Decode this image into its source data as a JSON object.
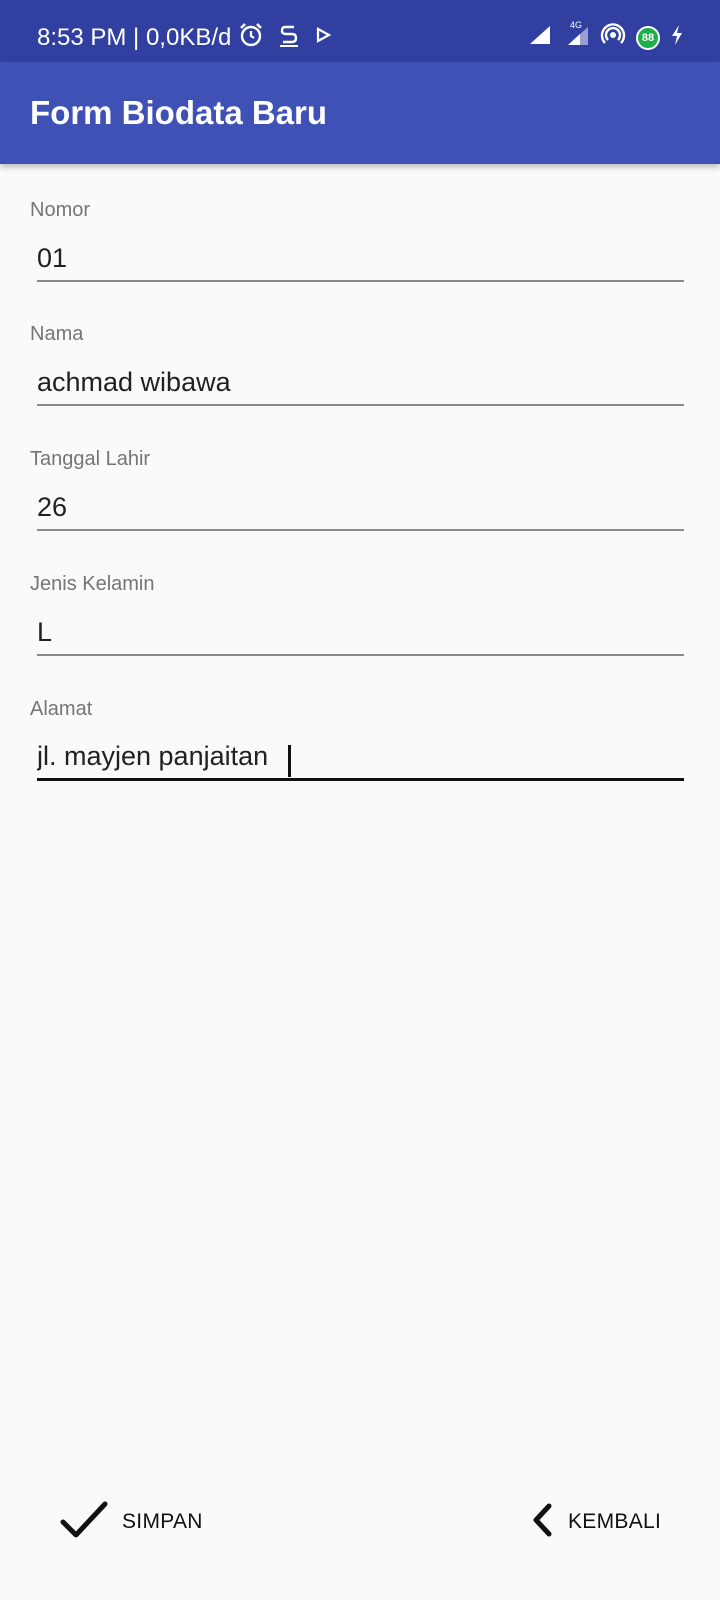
{
  "status_bar": {
    "time": "8:53 PM | 0,0KB/d",
    "network_type": "4G",
    "battery_level": "88",
    "icons": [
      "alarm-icon",
      "s-app-icon",
      "play-icon",
      "signal-icon",
      "signal-4g-icon",
      "hotspot-icon",
      "battery-icon",
      "charging-icon"
    ]
  },
  "app_bar": {
    "title": "Form Biodata Baru",
    "color": "#3f51b5"
  },
  "form": {
    "fields": [
      {
        "label": "Nomor",
        "value": "01"
      },
      {
        "label": "Nama",
        "value": "achmad wibawa"
      },
      {
        "label": "Tanggal Lahir",
        "value": "26"
      },
      {
        "label": "Jenis Kelamin",
        "value": "L"
      },
      {
        "label": "Alamat",
        "value": "jl. mayjen panjaitan"
      }
    ]
  },
  "actions": {
    "save_label": "SIMPAN",
    "back_label": "KEMBALI"
  }
}
